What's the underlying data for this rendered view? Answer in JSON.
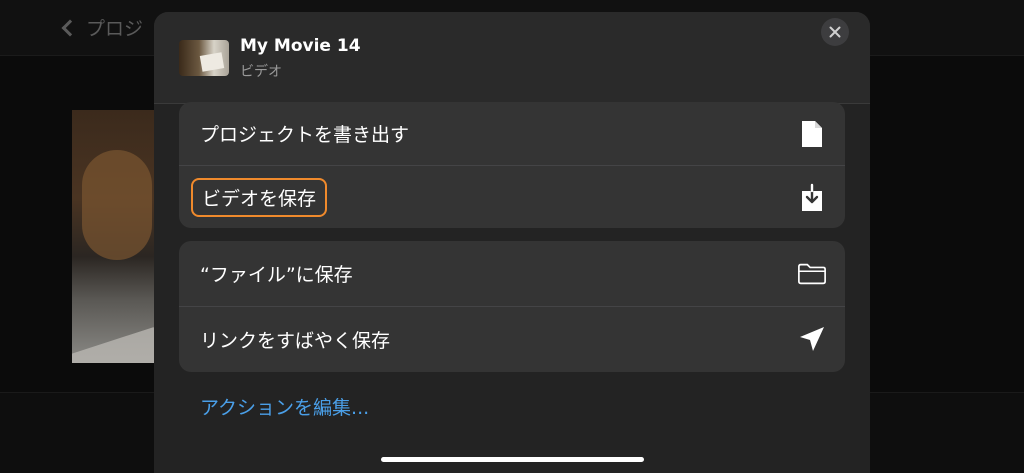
{
  "background": {
    "back_label": "プロジ"
  },
  "sheet": {
    "title": "My Movie 14",
    "subtitle": "ビデオ",
    "close_icon": "close-icon",
    "group1": [
      {
        "label": "プロジェクトを書き出す",
        "icon": "document-icon"
      },
      {
        "label": "ビデオを保存",
        "icon": "download-icon",
        "highlight_color": "#f08a2c"
      }
    ],
    "group2": [
      {
        "label": "“ファイル”に保存",
        "icon": "folder-icon"
      },
      {
        "label": "リンクをすばやく保存",
        "icon": "send-icon"
      }
    ],
    "edit_actions": "アクションを編集..."
  },
  "colors": {
    "link": "#4a9fe8",
    "highlight": "#f08a2c"
  }
}
